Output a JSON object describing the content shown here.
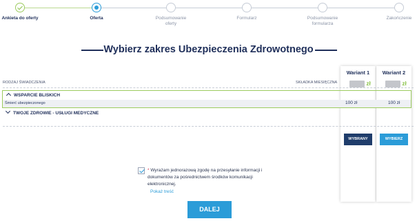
{
  "stepper": {
    "steps": [
      {
        "label": "Ankieta do oferty",
        "state": "done"
      },
      {
        "label": "Oferta",
        "state": "current"
      },
      {
        "label": "Podsumowanie oferty",
        "state": "todo"
      },
      {
        "label": "Formularz",
        "state": "todo"
      },
      {
        "label": "Podsumowanie formularza",
        "state": "todo"
      },
      {
        "label": "Zakończenie",
        "state": "todo"
      }
    ]
  },
  "page": {
    "title": "Wybierz zakres Ubezpieczenia Zdrowotnego"
  },
  "table": {
    "col_left": "RODZAJ ŚWIADCZENIA",
    "col_mid": "SKŁADKA MIESIĘCZNA",
    "variants": [
      {
        "name": "Wariant 1",
        "currency": "zł",
        "button": "WYBRANY"
      },
      {
        "name": "Wariant 2",
        "currency": "zł",
        "button": "WYBIERZ"
      }
    ],
    "sections": [
      {
        "title": "WSPARCIE BLISKICH",
        "expanded": true,
        "rows": [
          {
            "label": "Śmierć ubezpieczonego",
            "v1": "100 zł",
            "v2": "100 zł"
          }
        ]
      },
      {
        "title": "TWOJE ZDROWIE - USŁUGI MEDYCZNE",
        "expanded": false
      }
    ]
  },
  "consent": {
    "required_mark": "*",
    "text": "Wyrażam jednorazową zgodę na przesyłanie informacji i dokumentów za pośrednictwem środków komunikacji elektronicznej.",
    "checked": true,
    "show_link": "Pokaż treść"
  },
  "next_button": "DALEJ",
  "colors": {
    "accent": "#2b9cd8",
    "navy": "#1f2f5a",
    "success": "#8bc34a",
    "required": "#d9304c"
  }
}
